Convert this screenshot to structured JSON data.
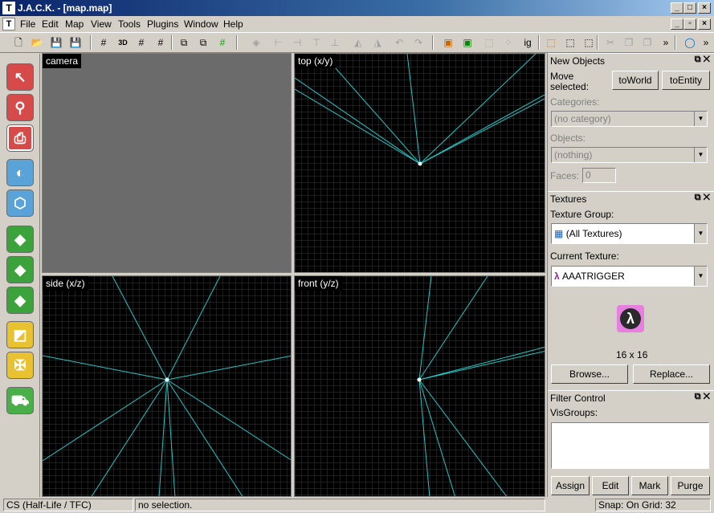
{
  "window": {
    "title": "J.A.C.K. - [map.map]",
    "controls": [
      "_",
      "□",
      "×"
    ],
    "doc_controls": [
      "_",
      "▫",
      "×"
    ]
  },
  "menu": [
    "File",
    "Edit",
    "Map",
    "View",
    "Tools",
    "Plugins",
    "Window",
    "Help"
  ],
  "toolbar": {
    "chevron": "»"
  },
  "viewports": {
    "camera": "camera",
    "top": "top (x/y)",
    "side": "side (x/z)",
    "front": "front (y/z)"
  },
  "new_objects": {
    "header": "New Objects",
    "move_selected_line1": "Move",
    "move_selected_line2": "selected:",
    "to_world": "toWorld",
    "to_entity": "toEntity",
    "categories_label": "Categories:",
    "categories_value": "(no category)",
    "objects_label": "Objects:",
    "objects_value": "(nothing)",
    "faces_label": "Faces:",
    "faces_value": "0"
  },
  "textures": {
    "header": "Textures",
    "group_label": "Texture Group:",
    "group_value": "(All Textures)",
    "current_label": "Current Texture:",
    "current_value": "AAATRIGGER",
    "size": "16 x 16",
    "browse": "Browse...",
    "replace": "Replace..."
  },
  "filter": {
    "header": "Filter Control",
    "visgroups_label": "VisGroups:",
    "assign": "Assign",
    "edit": "Edit",
    "mark": "Mark",
    "purge": "Purge"
  },
  "status": {
    "game": "CS (Half-Life / TFC)",
    "selection": "no selection.",
    "snap": "Snap: On Grid: 32"
  },
  "colors": {
    "grid": "#3a3a3a",
    "camera_lines": "#22c7c7",
    "camera_bg": "#6b6b6b"
  }
}
